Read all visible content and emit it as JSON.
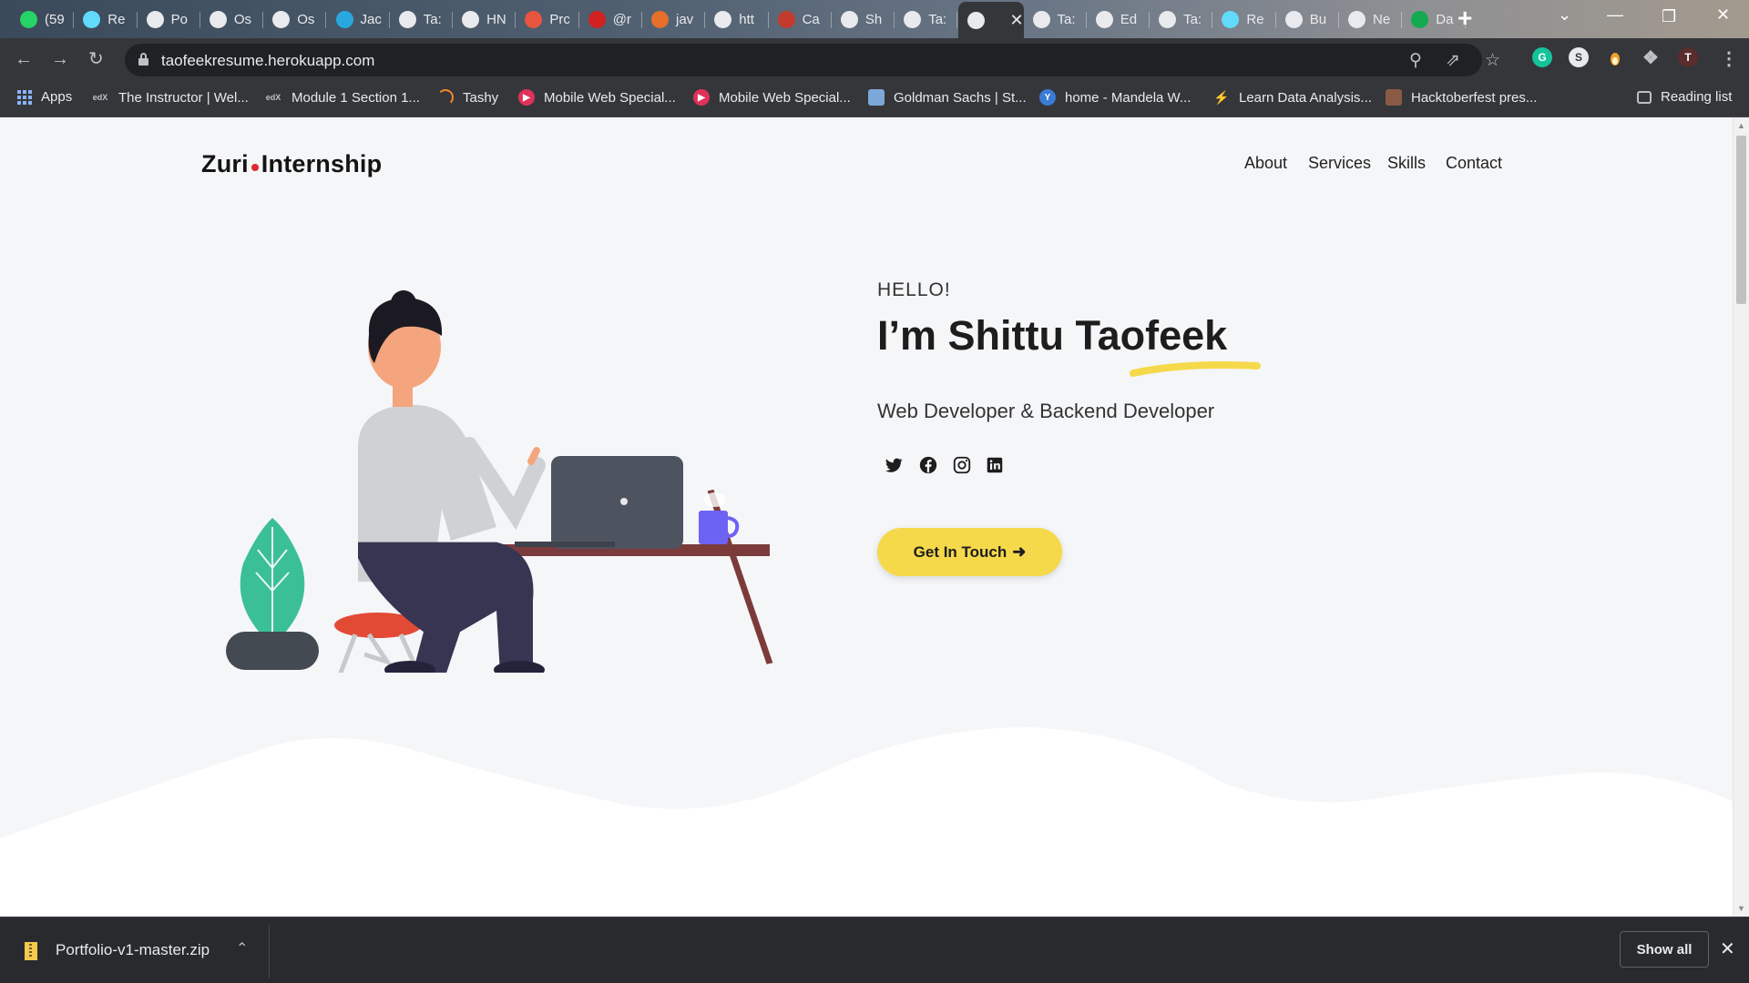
{
  "browser": {
    "tabs": [
      {
        "label": "(59",
        "icon": "whatsapp-icon",
        "color": "#25d366"
      },
      {
        "label": "Re",
        "icon": "react-icon",
        "color": "#61dafb"
      },
      {
        "label": "Po",
        "icon": "github-icon",
        "color": "#ffffff"
      },
      {
        "label": "Os",
        "icon": "tools-icon",
        "color": "#ffffff"
      },
      {
        "label": "Os",
        "icon": "github-icon",
        "color": "#ffffff"
      },
      {
        "label": "Jac",
        "icon": "t-logo-icon",
        "color": "#29a8e0"
      },
      {
        "label": "Ta:",
        "icon": "github-icon",
        "color": "#ffffff"
      },
      {
        "label": "HN",
        "icon": "github-icon",
        "color": "#ffffff"
      },
      {
        "label": "Prc",
        "icon": "p-logo-icon",
        "color": "#e8553f"
      },
      {
        "label": "@r",
        "icon": "n-logo-icon",
        "color": "#d12121"
      },
      {
        "label": "jav",
        "icon": "orange-logo-icon",
        "color": "#e66f2a"
      },
      {
        "label": "htt",
        "icon": "globe-icon",
        "color": "#ffffff"
      },
      {
        "label": "Ca",
        "icon": "quora-icon",
        "color": "#c33b2d"
      },
      {
        "label": "Sh",
        "icon": "tools-icon",
        "color": "#ffffff"
      },
      {
        "label": "Ta:",
        "icon": "github-icon",
        "color": "#ffffff"
      },
      {
        "label": "",
        "icon": "globe-icon",
        "color": "#ffffff",
        "active": true
      },
      {
        "label": "Ta:",
        "icon": "github-icon",
        "color": "#ffffff"
      },
      {
        "label": "Ed",
        "icon": "globe-icon",
        "color": "#ffffff"
      },
      {
        "label": "Ta:",
        "icon": "github-icon",
        "color": "#ffffff"
      },
      {
        "label": "Re",
        "icon": "react-icon",
        "color": "#61dafb"
      },
      {
        "label": "Bu",
        "icon": "globe-icon",
        "color": "#ffffff"
      },
      {
        "label": "Ne",
        "icon": "chrome-icon",
        "color": "#ffffff"
      },
      {
        "label": "Da",
        "icon": "leaf-icon",
        "color": "#13aa52"
      }
    ],
    "url": "taofeekresume.herokuapp.com",
    "profile_initial": "T",
    "bookmarks": [
      {
        "label": "Apps"
      },
      {
        "label": "The Instructor | Wel..."
      },
      {
        "label": "Module 1 Section 1..."
      },
      {
        "label": "Tashy"
      },
      {
        "label": "Mobile Web Special..."
      },
      {
        "label": "Mobile Web Special..."
      },
      {
        "label": "Goldman Sachs | St..."
      },
      {
        "label": "home - Mandela W..."
      },
      {
        "label": "Learn Data Analysis..."
      },
      {
        "label": "Hacktoberfest pres..."
      }
    ],
    "reading_list": "Reading list"
  },
  "site": {
    "logo_left": "Zuri",
    "logo_right": "Internship",
    "logo_dot_color": "#e0282e",
    "nav": [
      "About",
      "Services",
      "Skills",
      "Contact"
    ],
    "greeting": "HELLO!",
    "headline": "I’m Shittu Taofeek",
    "role": "Web Developer & Backend Developer",
    "social": [
      "twitter-icon",
      "facebook-icon",
      "instagram-icon",
      "linkedin-icon"
    ],
    "cta": "Get In Touch",
    "accent_color": "#f5d94a"
  },
  "downloads": {
    "file_name": "Portfolio-v1-master.zip",
    "show_all": "Show all"
  }
}
